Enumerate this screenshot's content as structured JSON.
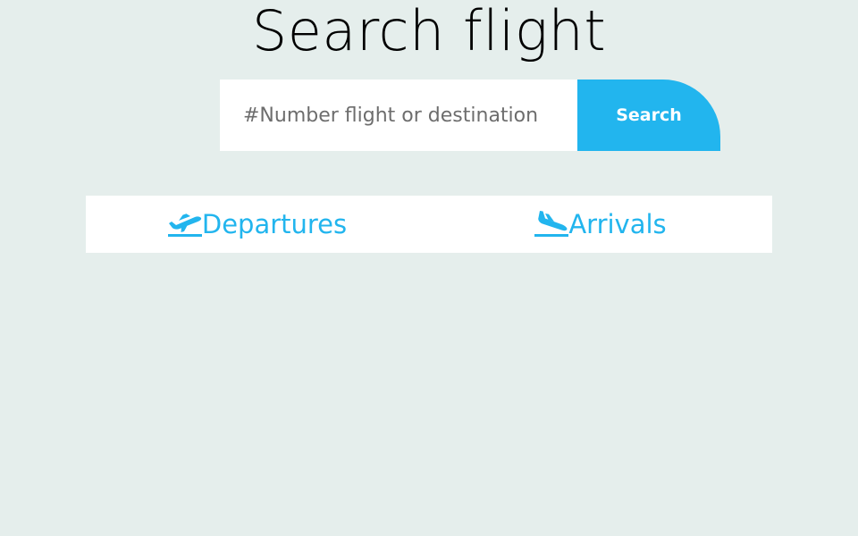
{
  "page": {
    "title": "Search flight"
  },
  "search": {
    "placeholder": "#Number flight or destination",
    "value": "",
    "button_label": "Search"
  },
  "tabs": [
    {
      "label": "Departures",
      "icon": "flight-takeoff-icon"
    },
    {
      "label": "Arrivals",
      "icon": "flight-land-icon"
    }
  ],
  "colors": {
    "accent": "#22b5ee",
    "background": "#e5eeec",
    "panel": "#ffffff"
  }
}
